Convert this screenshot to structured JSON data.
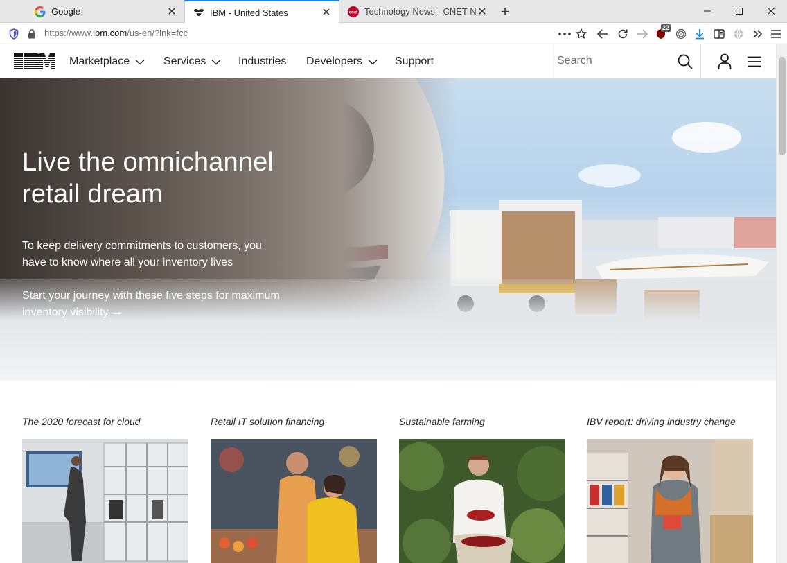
{
  "browser": {
    "tabs": [
      {
        "title": "Google",
        "favicon": "google-g-icon",
        "active": false
      },
      {
        "title": "IBM - United States",
        "favicon": "ibm-bee-icon",
        "active": true
      },
      {
        "title": "Technology News - CNET News",
        "favicon": "cnet-icon",
        "active": false
      }
    ],
    "url_prefix": "https://www.",
    "url_domain": "ibm.com",
    "url_path": "/us-en/?lnk=fcc",
    "ublock_count": "22",
    "accent_color": "#0a84ff"
  },
  "masthead": {
    "logo": "IBM",
    "nav": [
      {
        "label": "Marketplace",
        "has_menu": true
      },
      {
        "label": "Services",
        "has_menu": true
      },
      {
        "label": "Industries",
        "has_menu": false
      },
      {
        "label": "Developers",
        "has_menu": true
      },
      {
        "label": "Support",
        "has_menu": false
      }
    ],
    "search_placeholder": "Search"
  },
  "hero": {
    "title_line1": "Live the omnichannel",
    "title_line2": "retail dream",
    "body": "To keep delivery commitments to customers, you have to know where all your inventory lives",
    "link": "Start your journey with these five steps for maximum inventory visibility →"
  },
  "cards": [
    {
      "label": "The 2020 forecast for cloud"
    },
    {
      "label": "Retail IT solution financing"
    },
    {
      "label": "Sustainable farming"
    },
    {
      "label": "IBV report: driving industry change"
    }
  ]
}
